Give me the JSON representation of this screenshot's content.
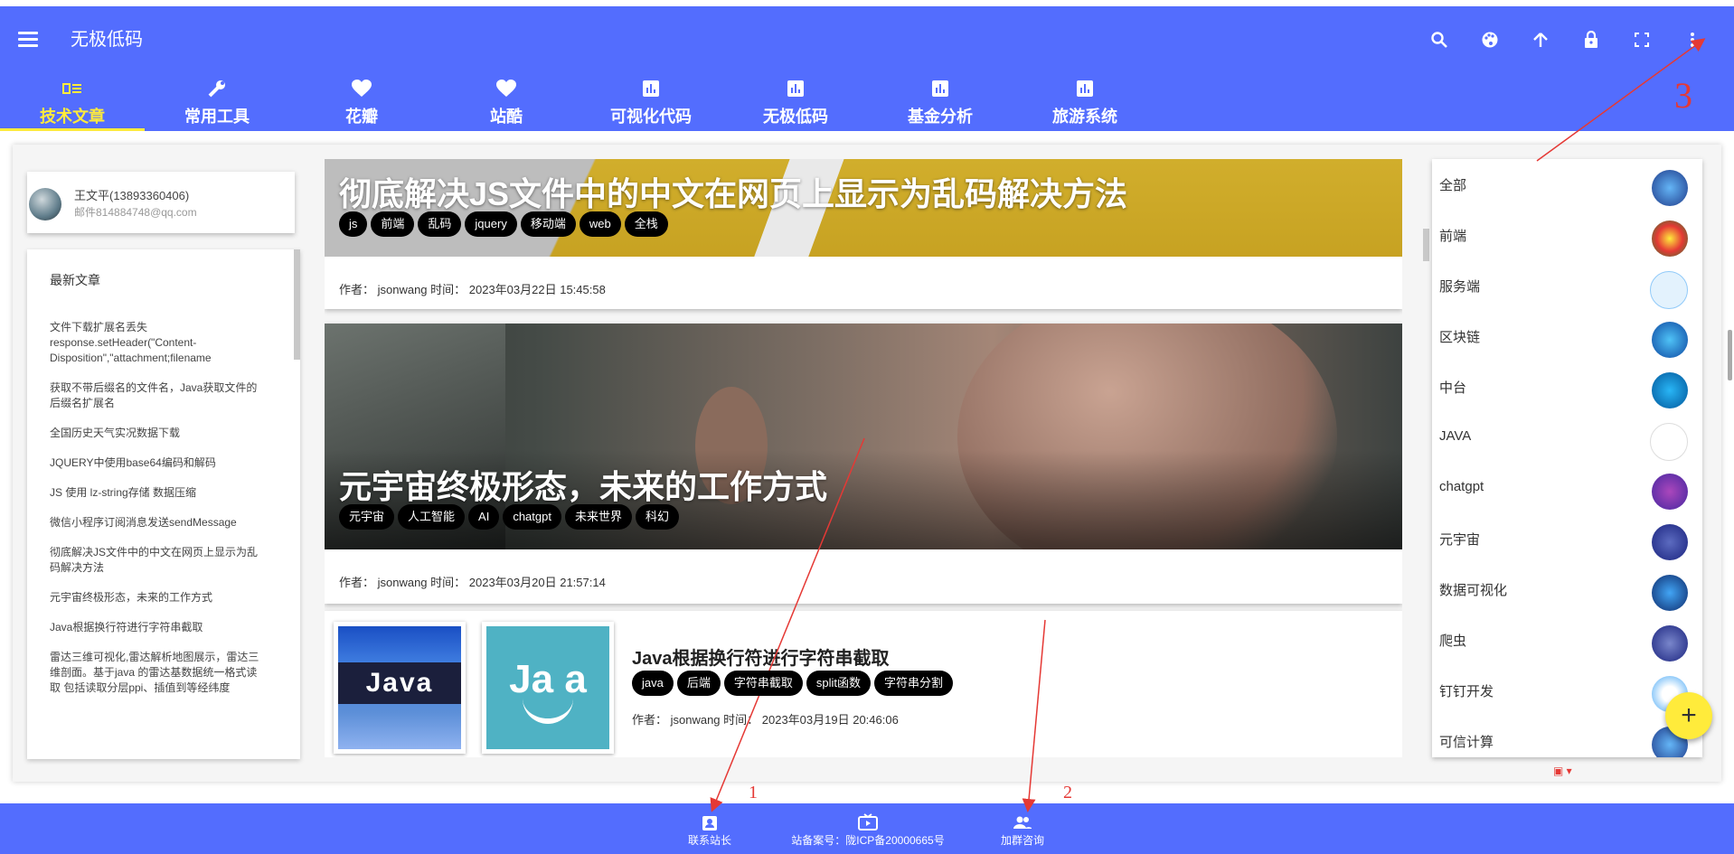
{
  "app": {
    "title": "无极低码"
  },
  "colors": {
    "primary": "#536dfe",
    "accent": "#ffeb3b",
    "annotation": "#e53935"
  },
  "top_icons": [
    "search-icon",
    "palette-icon",
    "arrow-up-icon",
    "lock-icon",
    "fullscreen-icon",
    "more-vert-icon"
  ],
  "tabs": [
    {
      "label": "技术文章",
      "icon": "article-icon",
      "active": true
    },
    {
      "label": "常用工具",
      "icon": "wrench-icon"
    },
    {
      "label": "花瓣",
      "icon": "heart-icon"
    },
    {
      "label": "站酷",
      "icon": "heart-icon"
    },
    {
      "label": "可视化代码",
      "icon": "chart-icon"
    },
    {
      "label": "无极低码",
      "icon": "chart-icon"
    },
    {
      "label": "基金分析",
      "icon": "chart-icon"
    },
    {
      "label": "旅游系统",
      "icon": "chart-icon"
    }
  ],
  "profile": {
    "name": "王文平(13893360406)",
    "email": "邮件814884748@qq.com"
  },
  "recent": {
    "heading": "最新文章",
    "items": [
      "文件下载扩展名丢失 response.setHeader(\"Content-Disposition\",\"attachment;filename",
      "获取不带后缀名的文件名，Java获取文件的后缀名扩展名",
      "全国历史天气实况数据下载",
      "JQUERY中使用base64编码和解码",
      "JS 使用 lz-string存储 数据压缩",
      "微信小程序订阅消息发送sendMessage",
      "彻底解决JS文件中的中文在网页上显示为乱码解决方法",
      "元宇宙终极形态，未来的工作方式",
      "Java根据换行符进行字符串截取",
      "雷达三维可视化,雷达解析地图展示，雷达三维剖面。基于java 的雷达基数据统一格式读取 包括读取分层ppi、插值到等经纬度"
    ]
  },
  "articles": [
    {
      "title": "彻底解决JS文件中的中文在网页上显示为乱码解决方法",
      "tags": [
        "js",
        "前端",
        "乱码",
        "jquery",
        "移动端",
        "web",
        "全栈"
      ],
      "meta": "作者：  jsonwang    时间：  2023年03月22日 15:45:58"
    },
    {
      "title": "元宇宙终极形态，未来的工作方式",
      "tags": [
        "元宇宙",
        "人工智能",
        "AI",
        "chatgpt",
        "未来世界",
        "科幻"
      ],
      "meta": "作者：  jsonwang    时间：  2023年03月20日 21:57:14"
    },
    {
      "title": "Java根据换行符进行字符串截取",
      "tags": [
        "java",
        "后端",
        "字符串截取",
        "split函数",
        "字符串分割"
      ],
      "meta": "作者：  jsonwang    时间：  2023年03月19日 20:46:06",
      "thumb1_text": "Java",
      "thumb2_text": "Ja  a"
    }
  ],
  "categories": [
    {
      "label": "全部",
      "color": "#1e3a8a"
    },
    {
      "label": "前端",
      "color": "#c0392b"
    },
    {
      "label": "服务端",
      "color": "#e3f2fd"
    },
    {
      "label": "区块链",
      "color": "#0d47a1"
    },
    {
      "label": "中台",
      "color": "#01579b"
    },
    {
      "label": "JAVA",
      "color": "#ffffff"
    },
    {
      "label": "chatgpt",
      "color": "#4527a0"
    },
    {
      "label": "元宇宙",
      "color": "#1a237e"
    },
    {
      "label": "数据可视化",
      "color": "#0d2a6b"
    },
    {
      "label": "爬虫",
      "color": "#1a237e"
    },
    {
      "label": "钉钉开发",
      "color": "#e3f2fd"
    },
    {
      "label": "可信计算",
      "color": "#1e3a8a"
    }
  ],
  "footer": {
    "contact": "联系站长",
    "icp": "站备案号：陇ICP备20000665号",
    "group": "加群咨询"
  },
  "annotations": {
    "a1": "1",
    "a2": "2",
    "a3": "3"
  }
}
